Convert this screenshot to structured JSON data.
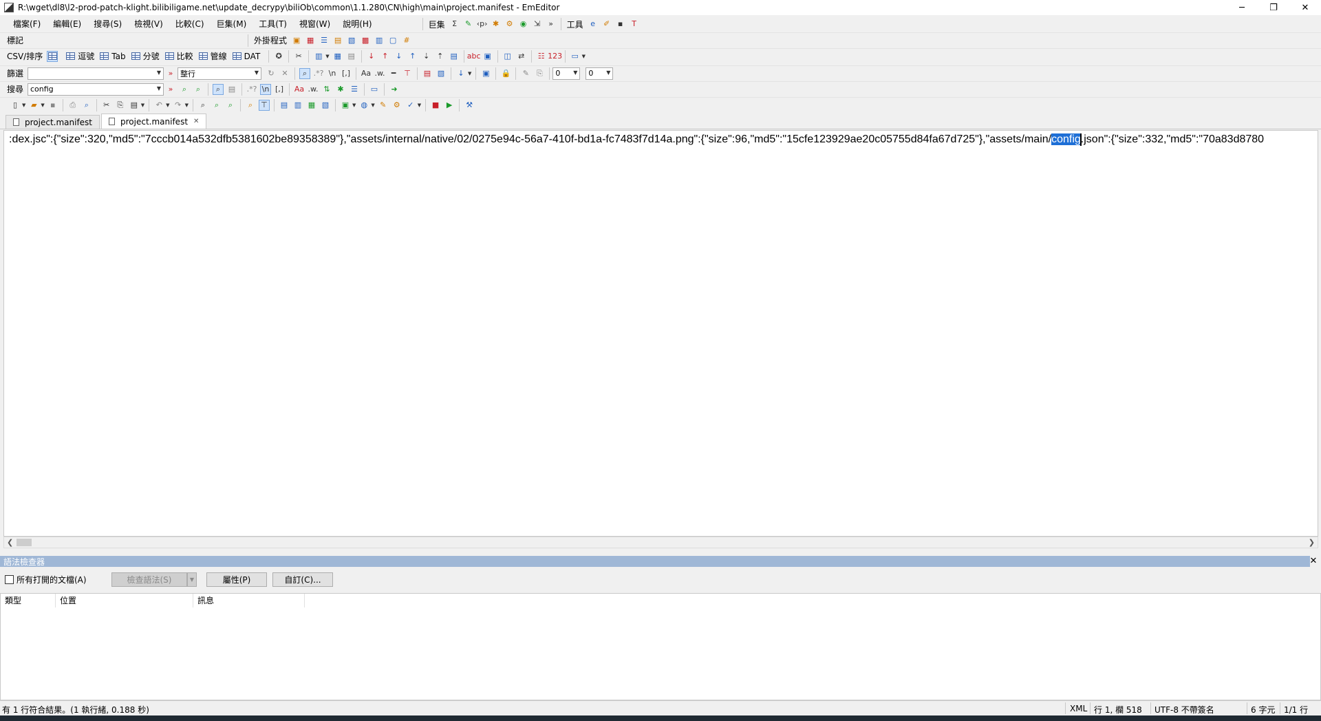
{
  "window": {
    "title": "R:\\wget\\dl8\\l2-prod-patch-klight.bilibiligame.net\\update_decrypy\\biliOb\\common\\1.1.280\\CN\\high\\main\\project.manifest - EmEditor",
    "min": "─",
    "max": "❐",
    "close": "✕"
  },
  "menu": {
    "items": [
      "檔案(F)",
      "編輯(E)",
      "搜尋(S)",
      "檢視(V)",
      "比較(C)",
      "巨集(M)",
      "工具(T)",
      "視窗(W)",
      "說明(H)"
    ],
    "macros_label": "巨集",
    "tools_label": "工具"
  },
  "toolbars": {
    "bookmark_label": "標記",
    "plugins_label": "外掛程式",
    "csv_label": "CSV/排序",
    "csv_modes": [
      "逗號",
      "Tab",
      "分號",
      "比較",
      "管線",
      "DAT"
    ],
    "filter_label": "篩選",
    "filter_value": "",
    "wrap_mode": "整行",
    "find_label": "搜尋",
    "find_value": "config",
    "num1": "0",
    "num2": "0"
  },
  "tabs": [
    "project.manifest",
    "project.manifest"
  ],
  "editor": {
    "text_before": ":dex.jsc\":{\"size\":320,\"md5\":\"7cccb014a532dfb5381602be89358389\"},\"assets/internal/native/02/0275e94c-56a7-410f-bd1a-fc7483f7d14a.png\":{\"size\":96,\"md5\":\"15cfe123929ae20c05755d84fa67d725\"},\"assets/main/",
    "highlight": "config",
    "text_after": ".json\":{\"size\":332,\"md5\":\"70a83d8780"
  },
  "syntax_panel": {
    "title": "語法檢查器",
    "all_docs_label": "所有打開的文檔(A)",
    "check_button": "檢查語法(S)",
    "properties_button": "屬性(P)",
    "customize_button": "自訂(C)...",
    "columns": [
      "類型",
      "位置",
      "訊息"
    ]
  },
  "status": {
    "message": "有 1 行符合結果。(1 執行緒, 0.188 秒)",
    "mode": "XML",
    "position": "行 1, 欄 518",
    "encoding": "UTF-8 不帶簽名",
    "chars": "6 字元",
    "pages": "1/1 行"
  }
}
